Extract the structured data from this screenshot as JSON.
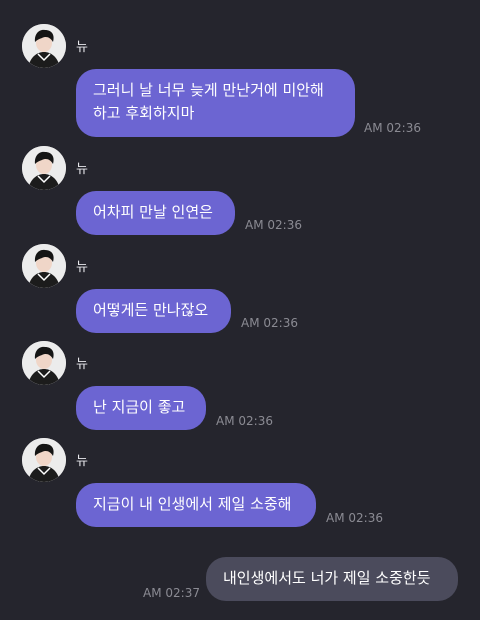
{
  "messages": [
    {
      "sender": "뉴",
      "text": "그러니 날 너무 늦게 만난거에 미안해\n하고 후회하지마",
      "time": "AM 02:36"
    },
    {
      "sender": "뉴",
      "text": "어차피 만날 인연은",
      "time": "AM 02:36"
    },
    {
      "sender": "뉴",
      "text": "어떻게든 만나잖오",
      "time": "AM 02:36"
    },
    {
      "sender": "뉴",
      "text": "난 지금이 좋고",
      "time": "AM 02:36"
    },
    {
      "sender": "뉴",
      "text": "지금이 내 인생에서 제일 소중해",
      "time": "AM 02:36"
    }
  ],
  "my_message": {
    "text": "내인생에서도 너가 제일 소중한듯",
    "time": "AM 02:37"
  },
  "colors": {
    "background": "#25252d",
    "received_bubble": "#6c65d2",
    "sent_bubble": "#4b4b5c",
    "timestamp": "#8b8b93"
  },
  "icons": {
    "avatar": "profile-photo-avatar"
  }
}
